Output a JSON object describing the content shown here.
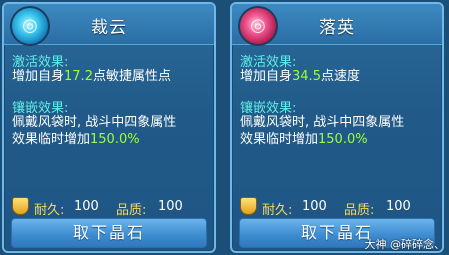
{
  "cards": [
    {
      "title": "裁云",
      "activation_label": "激活效果:",
      "activation_pre": "增加自身",
      "activation_value": "17.2",
      "activation_post": "点敏捷属性点",
      "inlay_label": "镶嵌效果:",
      "inlay_line1": "佩戴风袋时, 战斗中四象属性",
      "inlay_line2_pre": "效果临时增加",
      "inlay_line2_value": "150.0%",
      "durability_label": "耐久:",
      "durability_value": "100",
      "quality_label": "品质:",
      "quality_value": "100",
      "button_label": "取下晶石",
      "orb_color": "#3cc9ee"
    },
    {
      "title": "落英",
      "activation_label": "激活效果:",
      "activation_pre": "增加自身",
      "activation_value": "34.5",
      "activation_post": "点速度",
      "inlay_label": "镶嵌效果:",
      "inlay_line1": "佩戴风袋时, 战斗中四象属性",
      "inlay_line2_pre": "效果临时增加",
      "inlay_line2_value": "150.0%",
      "durability_label": "耐久:",
      "durability_value": "100",
      "quality_label": "品质:",
      "quality_value": "100",
      "button_label": "取下晶石",
      "orb_color": "#f0558e"
    }
  ],
  "colors": {
    "highlight": "#9cff3a",
    "label": "#5ff0e8",
    "stat_label": "#f6d85a"
  },
  "watermark": "大神 @碎碎念、"
}
